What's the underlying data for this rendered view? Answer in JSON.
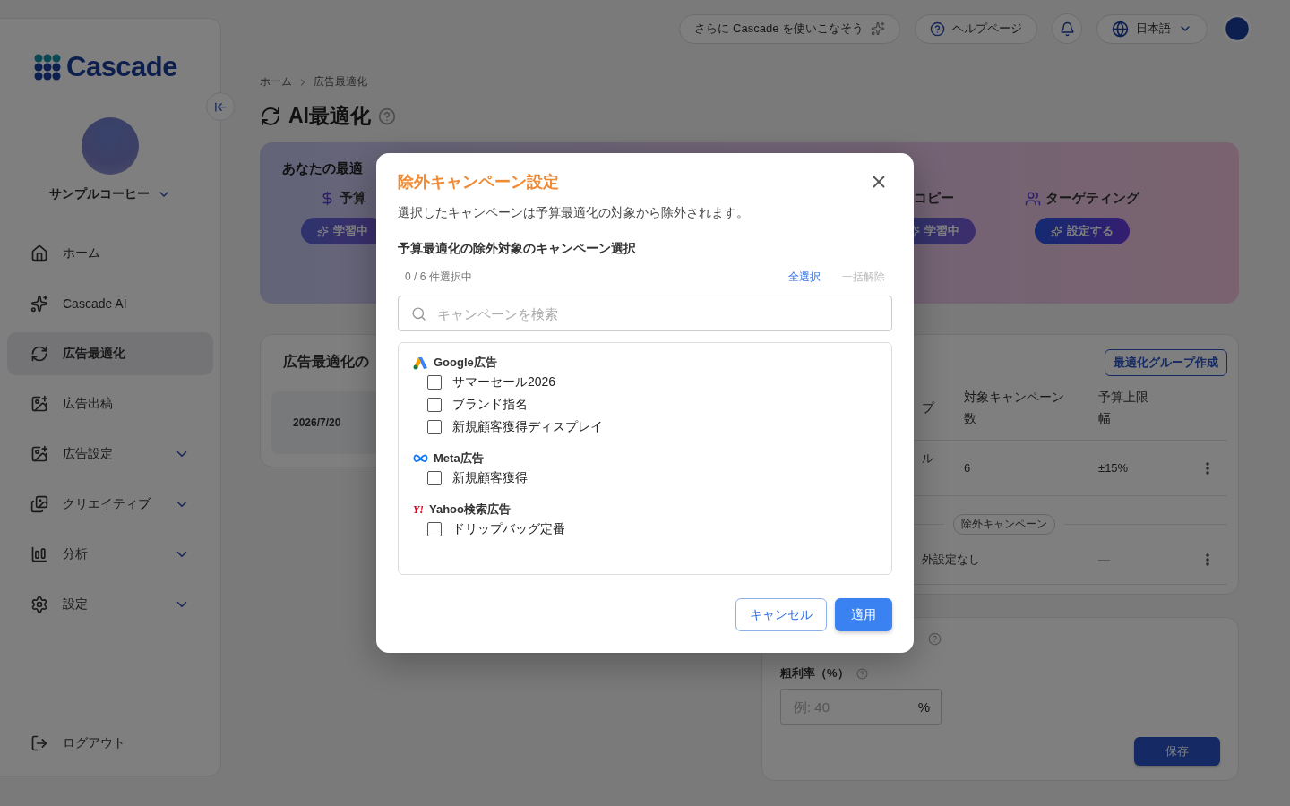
{
  "topbar": {
    "promo": "さらに Cascade を使いこなそう",
    "help": "ヘルプページ",
    "language": "日本語"
  },
  "sidebar": {
    "logo": "Cascade",
    "account": "サンプルコーヒー",
    "items": [
      {
        "label": "ホーム",
        "selected": false,
        "expandable": false
      },
      {
        "label": "Cascade AI",
        "selected": false,
        "expandable": false
      },
      {
        "label": "広告最適化",
        "selected": true,
        "expandable": false
      },
      {
        "label": "広告出稿",
        "selected": false,
        "expandable": false
      },
      {
        "label": "広告設定",
        "selected": false,
        "expandable": true
      },
      {
        "label": "クリエイティブ",
        "selected": false,
        "expandable": true
      },
      {
        "label": "分析",
        "selected": false,
        "expandable": true
      },
      {
        "label": "設定",
        "selected": false,
        "expandable": true
      }
    ],
    "logout": "ログアウト"
  },
  "breadcrumb": [
    "ホーム",
    "広告最適化"
  ],
  "page_title": "AI最適化",
  "hero": {
    "title": "あなたの最適",
    "items": [
      {
        "label": "予算",
        "badge": "学習中",
        "kind": "learning"
      },
      {
        "label": "コピー",
        "badge": "学習中",
        "kind": "learning"
      },
      {
        "label": "ターゲティング",
        "badge": "設定する",
        "kind": "action"
      }
    ]
  },
  "history_card": {
    "title": "広告最適化の",
    "date": "2026/7/20"
  },
  "groups_card": {
    "create_button": "最適化グループ作成",
    "columns": [
      "プ",
      "対象キャンペーン数",
      "予算上限幅"
    ],
    "rows": [
      {
        "column_1": "ル",
        "column_2": "6",
        "column_3": "±15%"
      }
    ],
    "divider_label": "除外キャンペーン",
    "excluded_row": {
      "column_1": "外設定なし",
      "column_3": "—"
    }
  },
  "margin_card": {
    "label": "粗利率（%）",
    "placeholder": "例: 40",
    "unit": "%",
    "save": "保存"
  },
  "dialog": {
    "title": "除外キャンペーン設定",
    "description": "選択したキャンペーンは予算最適化の対象から除外されます。",
    "section": "予算最適化の除外対象のキャンペーン選択",
    "count": "0 / 6 件選択中",
    "links": [
      {
        "label": "全選択",
        "disabled": false
      },
      {
        "label": "一括解除",
        "disabled": true
      }
    ],
    "search": {
      "placeholder": "キャンペーンを検索"
    },
    "groups": [
      {
        "kind": "google",
        "name": "Google広告",
        "campaigns": [
          {
            "label": "サマーセール2026",
            "checked": false
          },
          {
            "label": "ブランド指名",
            "checked": false
          },
          {
            "label": "新規顧客獲得ディスプレイ",
            "checked": false
          }
        ]
      },
      {
        "kind": "meta",
        "name": "Meta広告",
        "campaigns": [
          {
            "label": "新規顧客獲得",
            "checked": false
          }
        ]
      },
      {
        "kind": "yahoo",
        "mark": "Y!",
        "name": "Yahoo検索広告",
        "campaigns": [
          {
            "label": "ドリップバッグ定番",
            "checked": false
          }
        ]
      }
    ],
    "buttons": {
      "cancel": "キャンセル",
      "apply": "適用"
    }
  }
}
